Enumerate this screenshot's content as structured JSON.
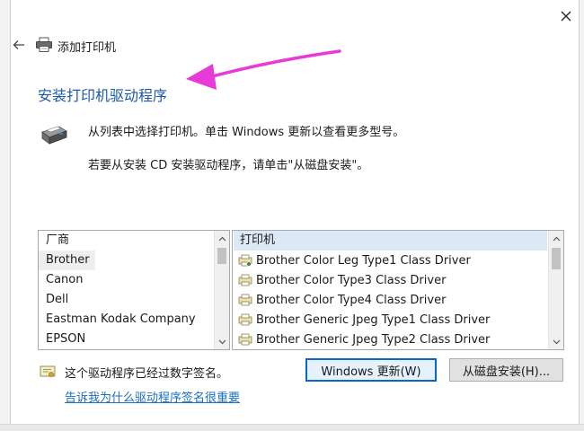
{
  "dialog": {
    "title": "添加打印机",
    "heading": "安装打印机驱动程序",
    "instruction_1": "从列表中选择打印机。单击 Windows 更新以查看更多型号。",
    "instruction_2": "若要从安装 CD 安装驱动程序，请单击\"从磁盘安装\"。"
  },
  "manufacturer_list": {
    "header": "厂商",
    "items": [
      "Brother",
      "Canon",
      "Dell",
      "Eastman Kodak Company",
      "EPSON"
    ],
    "selected": "Brother"
  },
  "printer_list": {
    "header": "打印机",
    "items": [
      "Brother Color Leg Type1 Class Driver",
      "Brother Color Type3 Class Driver",
      "Brother Color Type4 Class Driver",
      "Brother Generic Jpeg Type1 Class Driver",
      "Brother Generic Jpeg Type2 Class Driver"
    ]
  },
  "signature": {
    "status_text": "这个驱动程序已经过数字签名。",
    "link_text": "告诉我为什么驱动程序签名很重要"
  },
  "buttons": {
    "windows_update": "Windows 更新(W)",
    "have_disk": "从磁盘安装(H)..."
  },
  "icons": {
    "close": "close-icon",
    "back": "back-arrow-icon",
    "title_printer": "printer-icon",
    "big_printer": "printer-icon",
    "driver_item": "printer-driver-icon",
    "certificate": "certificate-icon",
    "annotation_arrow": "annotation-arrow"
  },
  "colors": {
    "heading": "#1c5aa6",
    "link": "#1a6fbf",
    "annotation_arrow": "#e83ad6",
    "default_button_border": "#0a64c9",
    "list_header_highlight": "#dbe9f7"
  }
}
